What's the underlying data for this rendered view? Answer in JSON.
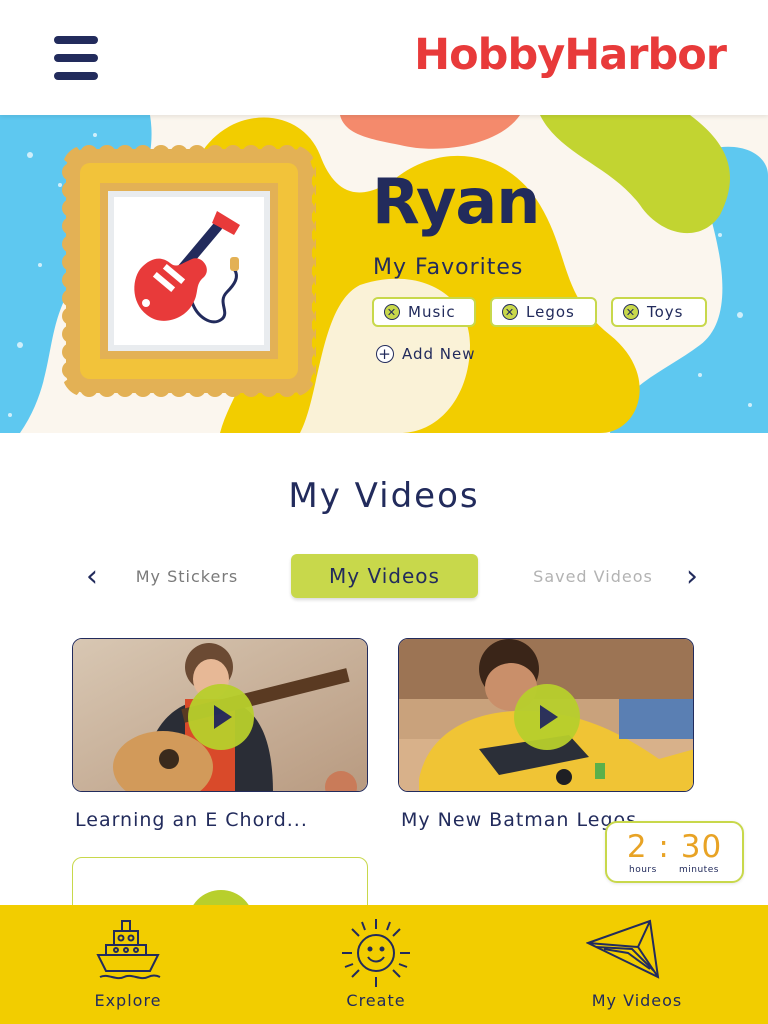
{
  "header": {
    "menu_icon": "hamburger-menu-icon",
    "logo": "HobbyHarbor"
  },
  "profile": {
    "name": "Ryan",
    "avatar_icon": "electric-guitar-icon",
    "favorites_title": "My Favorites",
    "favorites": [
      "Music",
      "Legos",
      "Toys"
    ],
    "add_new_label": "Add New"
  },
  "videos_section": {
    "title": "My Videos",
    "tabs": [
      "My Stickers",
      "My Videos",
      "Saved Videos"
    ],
    "active_tab": "My Videos",
    "videos": [
      {
        "title": "Learning an E Chord..."
      },
      {
        "title": "My New  Batman Legos"
      }
    ]
  },
  "timer": {
    "hours": "2",
    "separator": ":",
    "minutes": "30",
    "hours_label": "hours",
    "minutes_label": "minutes"
  },
  "bottom_nav": [
    {
      "label": "Explore",
      "icon": "boat-icon"
    },
    {
      "label": "Create",
      "icon": "sun-icon"
    },
    {
      "label": "My Videos",
      "icon": "paper-plane-icon"
    }
  ],
  "colors": {
    "navy": "#222b5c",
    "brand_red": "#e83a3a",
    "lime": "#c8d84b",
    "yellow": "#f2cd00",
    "orange": "#e8a325",
    "sky": "#5ec8f0"
  }
}
